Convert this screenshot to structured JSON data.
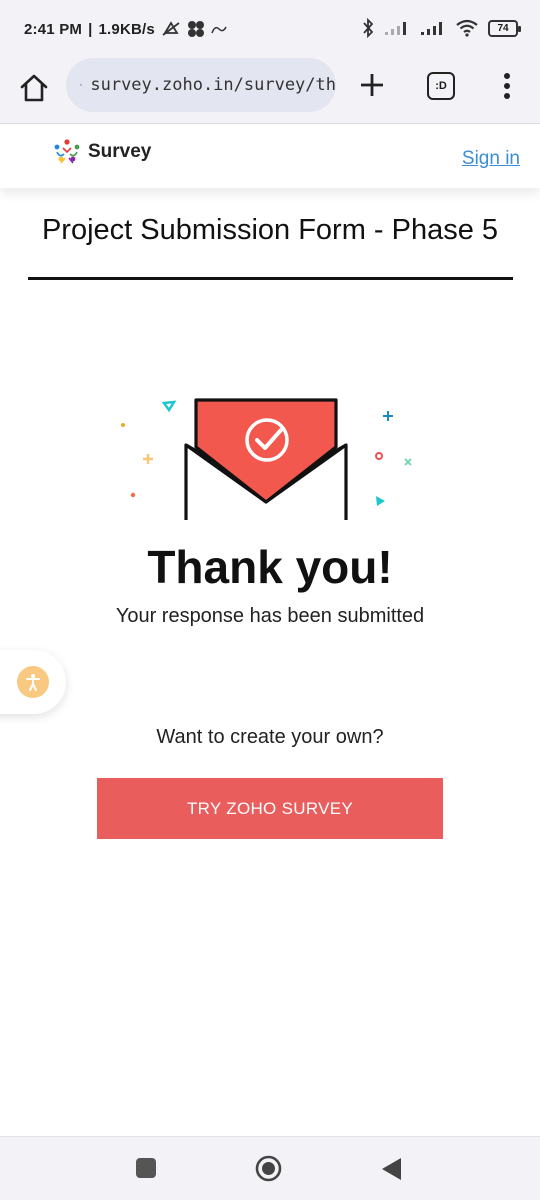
{
  "status_bar": {
    "time": "2:41 PM",
    "net_speed": "1.9KB/s",
    "battery": "74"
  },
  "browser": {
    "url": "survey.zoho.in/survey/th",
    "tabs_label": ":D"
  },
  "site_header": {
    "logo_text": "Survey",
    "signin_label": "Sign in"
  },
  "page": {
    "form_title": "Project Submission Form - Phase 5",
    "thanks_heading": "Thank you!",
    "submitted_message": "Your response has been submitted",
    "cta_prompt": "Want to create your own?",
    "cta_label": "TRY ZOHO SURVEY"
  },
  "colors": {
    "accent_red": "#e95d5d",
    "envelope_red": "#f2584e",
    "link_blue": "#3a8dd8",
    "a11y_badge": "#f9c982"
  }
}
